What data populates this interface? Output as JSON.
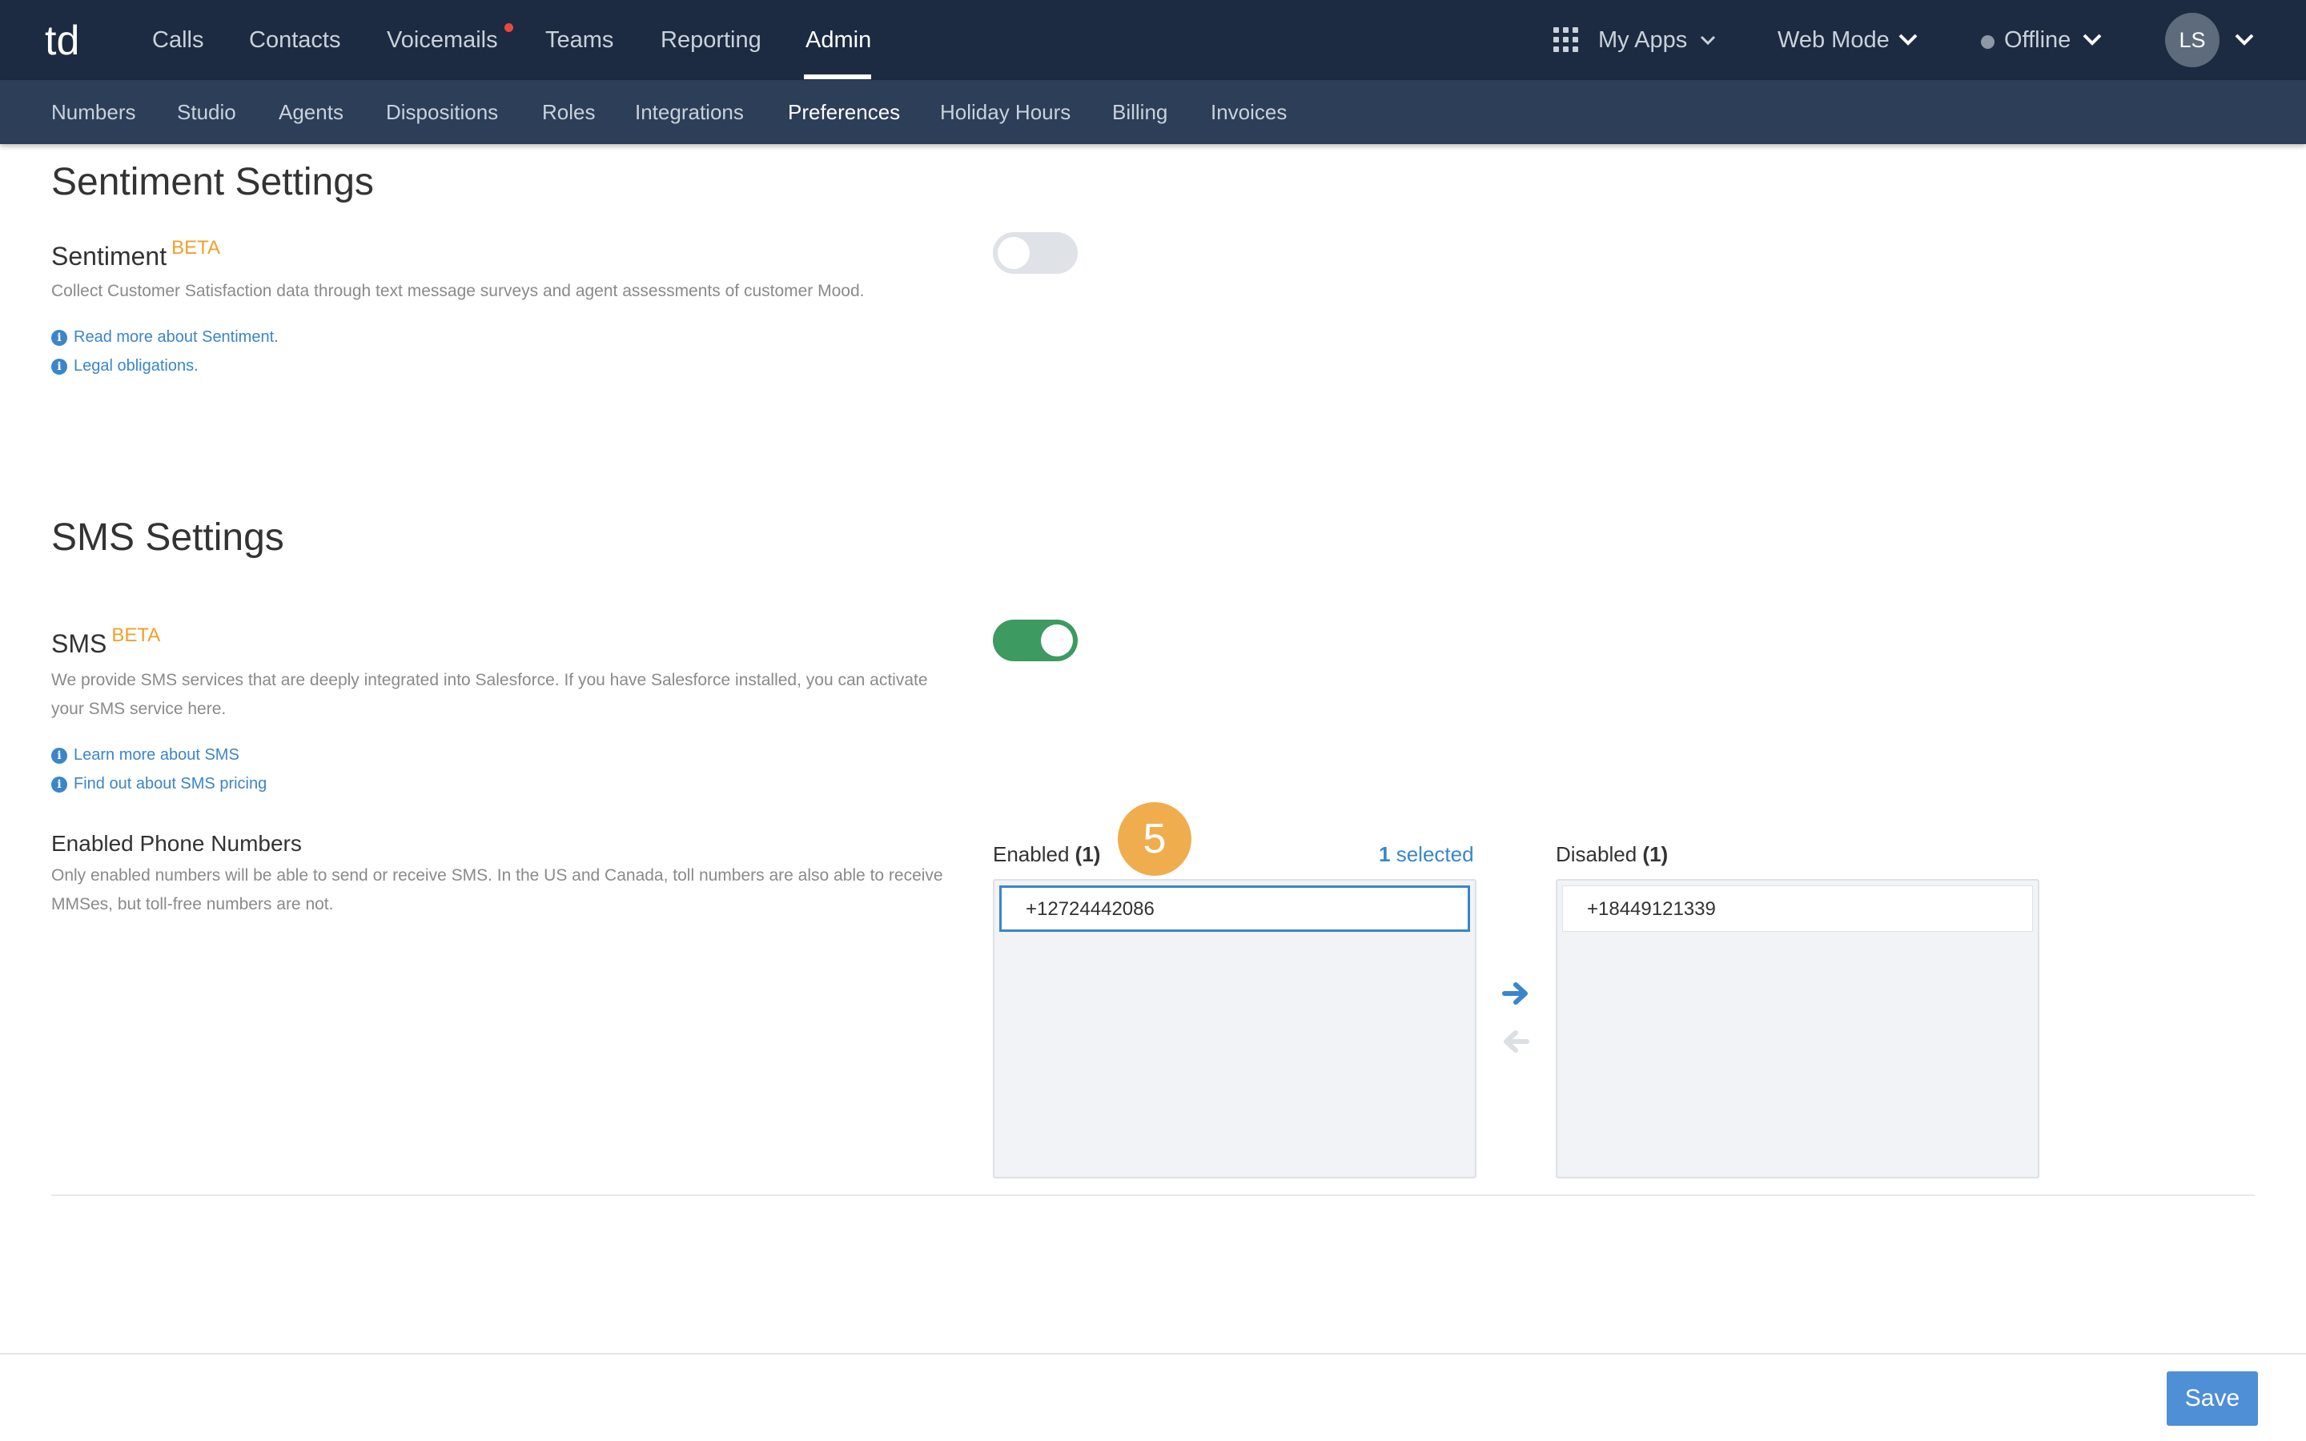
{
  "topnav": {
    "logo_text": "td",
    "items": [
      "Calls",
      "Contacts",
      "Voicemails",
      "Teams",
      "Reporting",
      "Admin"
    ],
    "active": "Admin",
    "apps_label": "My Apps",
    "mode_label": "Web Mode",
    "status_label": "Offline",
    "avatar_initials": "LS"
  },
  "subnav": {
    "items": [
      "Numbers",
      "Studio",
      "Agents",
      "Dispositions",
      "Roles",
      "Integrations",
      "Preferences",
      "Holiday Hours",
      "Billing",
      "Invoices"
    ],
    "active": "Preferences"
  },
  "sentiment": {
    "section_title": "Sentiment Settings",
    "label": "Sentiment",
    "beta": "BETA",
    "description": "Collect Customer Satisfaction data through text message surveys and agent assessments of customer Mood.",
    "links": [
      "Read more about Sentiment.",
      "Legal obligations."
    ],
    "enabled": false
  },
  "sms": {
    "section_title": "SMS Settings",
    "label": "SMS",
    "beta": "BETA",
    "description": "We provide SMS services that are deeply integrated into Salesforce. If you have Salesforce installed, you can activate your SMS service here.",
    "links": [
      "Learn more about SMS",
      "Find out about SMS pricing"
    ],
    "enabled": true,
    "phone_numbers": {
      "label": "Enabled Phone Numbers",
      "description": "Only enabled numbers will be able to send or receive SMS. In the US and Canada, toll numbers are also able to receive MMSes, but toll-free numbers are not.",
      "enabled_title": "Enabled",
      "enabled_count": "(1)",
      "selected_count": "1",
      "selected_label": "selected",
      "enabled_list": [
        "+12724442086"
      ],
      "disabled_title": "Disabled",
      "disabled_count": "(1)",
      "disabled_list": [
        "+18449121339"
      ]
    }
  },
  "step_badge": "5",
  "footer": {
    "save_label": "Save"
  },
  "colors": {
    "topbar": "#1c2b41",
    "subbar": "#2c3e58",
    "beta": "#f0a02a",
    "link": "#3a86c8",
    "toggle_on": "#3d9a60",
    "badge": "#f0ad4e",
    "save": "#4e8fd6"
  },
  "icons": [
    "apps-grid-icon",
    "chevron-down-icon",
    "info-icon",
    "arrow-right-icon",
    "arrow-left-icon",
    "status-dot-icon"
  ]
}
